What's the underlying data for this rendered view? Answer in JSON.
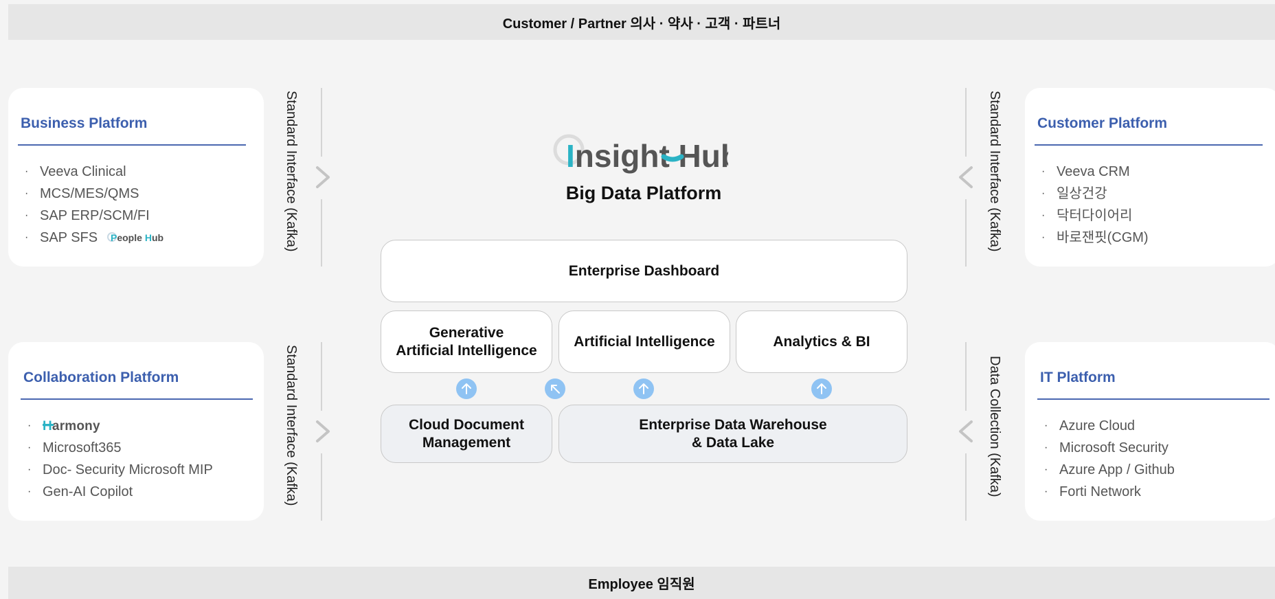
{
  "top_bar": "Customer / Partner 의사 · 약사 · 고객 · 파트너",
  "bottom_bar": "Employee 임직원",
  "business_platform": {
    "title": "Business Platform",
    "items": [
      "Veeva Clinical",
      "MCS/MES/QMS",
      "SAP ERP/SCM/FI",
      "SAP SFS"
    ],
    "peoplehub_logo": "People Hub"
  },
  "collaboration_platform": {
    "title": "Collaboration Platform",
    "harmony_logo": "Harmony",
    "items": [
      "Microsoft365",
      "Doc- Security Microsoft MIP",
      "Gen-AI Copilot"
    ]
  },
  "customer_platform": {
    "title": "Customer Platform",
    "items": [
      "Veeva CRM",
      "일상건강",
      "닥터다이어리",
      "바로잰핏(CGM)"
    ]
  },
  "it_platform": {
    "title": "IT Platform",
    "items": [
      "Azure Cloud",
      "Microsoft Security",
      "Azure App / Github",
      "Forti Network"
    ]
  },
  "interfaces": {
    "top_left": "Standard Interface (Kafka)",
    "bottom_left": "Standard Interface (Kafka)",
    "top_right": "Standard Interface (Kafka)",
    "bottom_right": "Data Collection (Kafka)"
  },
  "center": {
    "logo": "Insight Hub",
    "title": "Big Data Platform",
    "enterprise_dashboard": "Enterprise Dashboard",
    "gen_ai_line1": "Generative",
    "gen_ai_line2": "Artificial Intelligence",
    "ai": "Artificial Intelligence",
    "analytics": "Analytics & BI",
    "cloud_doc_line1": "Cloud Document",
    "cloud_doc_line2": "Management",
    "edw_line1": "Enterprise Data Warehouse",
    "edw_line2": "& Data Lake"
  },
  "colors": {
    "accent_blue": "#3c5fae",
    "logo_teal": "#2bb3c5",
    "arrow_blue": "#8fc3f3"
  }
}
